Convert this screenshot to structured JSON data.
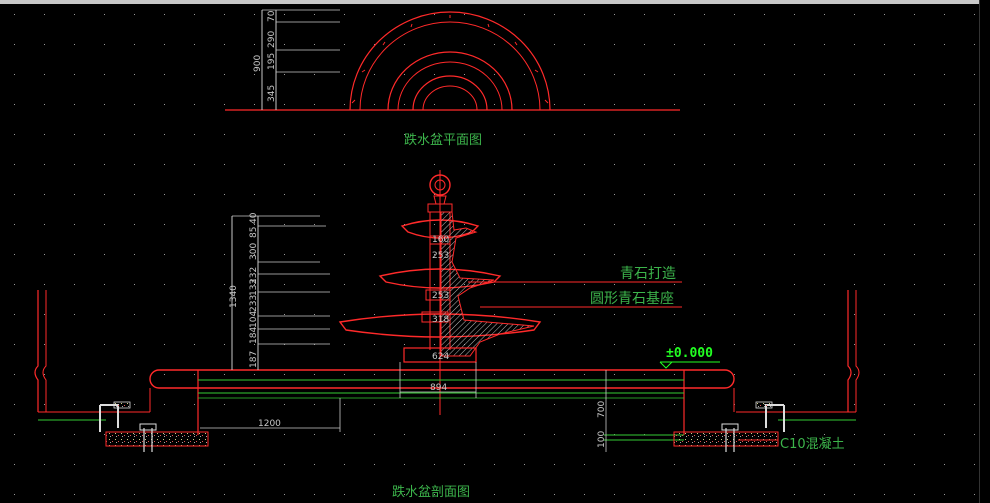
{
  "drawing": {
    "plan_title": "跌水盆平面图",
    "section_title": "跌水盆剖面图",
    "annotations": {
      "material_stone": "青石打造",
      "base": "圆形青石基座",
      "elevation": "±0.000",
      "concrete": "C10混凝土"
    },
    "plan_dims": {
      "total": "900",
      "segments": [
        "70",
        "290",
        "195",
        "345"
      ]
    },
    "section_dims": {
      "total": "1340",
      "segments": [
        "40",
        "85",
        "300",
        "232",
        "133",
        "233",
        "104",
        "184",
        "187"
      ],
      "radii": [
        "160",
        "253",
        "253",
        "318",
        "624"
      ],
      "base_width": "894",
      "pool_width": "1200",
      "depth": "700",
      "concrete_thickness": "100"
    }
  },
  "colors": {
    "background": "#000000",
    "structure": "#ff2a2a",
    "label": "#3cb44b",
    "elevation": "#22ff22",
    "dimension": "#c8c8c8",
    "green_line": "#33cc33",
    "hatch": "#bbbbbb"
  }
}
